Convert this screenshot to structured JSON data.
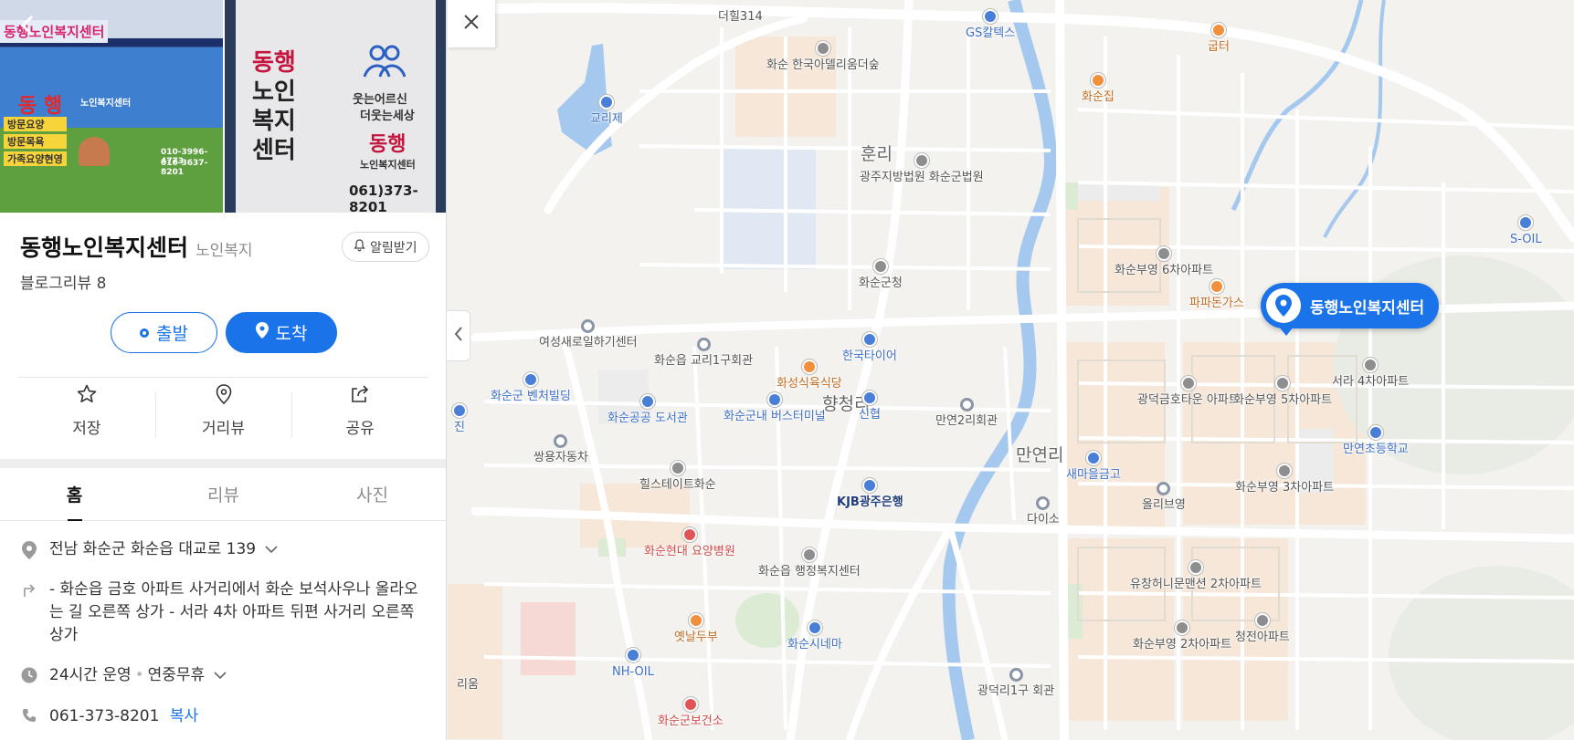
{
  "place": {
    "name": "동행노인복지센터",
    "category": "노인복지",
    "alarm_label": "알림받기",
    "blog_review": "블로그리뷰 8"
  },
  "photos": {
    "left_sign_top": "동행노인복지센터",
    "left_sign_main": "동 행",
    "left_sign_sub": "노인복지센터",
    "left_services": [
      "방문요양",
      "방문목욕",
      "가족요양현영"
    ],
    "left_phone_1": "010-3996-4773",
    "left_phone_2": "010-3637-8201",
    "right_vertical": [
      "동행",
      "노인",
      "복지",
      "센터"
    ],
    "right_slogan_1": "웃는어르신",
    "right_slogan_2": "더웃는세상",
    "right_brand": "동행",
    "right_brand_sub": "노인복지센터",
    "right_phone": "061)373-8201"
  },
  "route": {
    "start_label": "출발",
    "end_label": "도착"
  },
  "actions": [
    {
      "label": "저장",
      "icon": "star-icon"
    },
    {
      "label": "거리뷰",
      "icon": "map-pin-outline-icon"
    },
    {
      "label": "공유",
      "icon": "share-icon"
    }
  ],
  "tabs": [
    {
      "label": "홈",
      "active": true
    },
    {
      "label": "리뷰",
      "active": false
    },
    {
      "label": "사진",
      "active": false
    }
  ],
  "info": {
    "address": "전남 화순군 화순읍 대교로 139",
    "directions": "- 화순읍 금호 아파트 사거리에서 화순 보석사우나 올라오는 길 오른쪽 상가 - 서라 4차 아파트 뒤편 사거리 오른쪽 상가",
    "hours": "24시간 운영",
    "holiday": "연중무휴",
    "phone": "061-373-8201",
    "copy_label": "복사"
  },
  "map": {
    "marker_label": "동행노인복지센터",
    "labels": [
      {
        "text": "더힐314",
        "kind": "plain"
      },
      {
        "text": "GS칼텍스",
        "kind": "blue"
      },
      {
        "text": "굽터",
        "kind": "orange"
      },
      {
        "text": "화순 한국아델리움더숲",
        "kind": "poi"
      },
      {
        "text": "교리제",
        "kind": "blue"
      },
      {
        "text": "화순집",
        "kind": "orange"
      },
      {
        "text": "훈리",
        "kind": "area"
      },
      {
        "text": "광주지방법원 화순군법원",
        "kind": "poi"
      },
      {
        "text": "S-OIL",
        "kind": "blue"
      },
      {
        "text": "화순부영 6차아파트",
        "kind": "poi"
      },
      {
        "text": "화순군청",
        "kind": "poi"
      },
      {
        "text": "파파돈가스",
        "kind": "orange"
      },
      {
        "text": "여성새로일하기센터",
        "kind": "hole"
      },
      {
        "text": "화순읍 교리1구회관",
        "kind": "hole"
      },
      {
        "text": "한국타이어",
        "kind": "blue"
      },
      {
        "text": "화성식육식당",
        "kind": "orange"
      },
      {
        "text": "향청리",
        "kind": "area"
      },
      {
        "text": "신협",
        "kind": "blue"
      },
      {
        "text": "광덕금호타운 아파트",
        "kind": "poi"
      },
      {
        "text": "화순부영 5차아파트",
        "kind": "poi"
      },
      {
        "text": "서라 4차아파트",
        "kind": "poi"
      },
      {
        "text": "화순군 벤처빌딩",
        "kind": "blue"
      },
      {
        "text": "화순공공 도서관",
        "kind": "blue"
      },
      {
        "text": "화순군내 버스터미널",
        "kind": "blue"
      },
      {
        "text": "만연2리회관",
        "kind": "hole"
      },
      {
        "text": "만연초등학교",
        "kind": "blue"
      },
      {
        "text": "쌍용자동차",
        "kind": "hole"
      },
      {
        "text": "만연리",
        "kind": "area"
      },
      {
        "text": "새마을금고",
        "kind": "blue"
      },
      {
        "text": "힐스테이트화순",
        "kind": "poi"
      },
      {
        "text": "KJB광주은행",
        "kind": "bank"
      },
      {
        "text": "올리브영",
        "kind": "hole"
      },
      {
        "text": "화순부영 3차아파트",
        "kind": "poi"
      },
      {
        "text": "다이소",
        "kind": "hole"
      },
      {
        "text": "화순현대 요양병원",
        "kind": "red"
      },
      {
        "text": "화순읍 행정복지센터",
        "kind": "poi"
      },
      {
        "text": "유창허니문맨션 2차아파트",
        "kind": "poi"
      },
      {
        "text": "청전아파트",
        "kind": "poi"
      },
      {
        "text": "옛날두부",
        "kind": "orange"
      },
      {
        "text": "화순시네마",
        "kind": "blue"
      },
      {
        "text": "화순부영 2차아파트",
        "kind": "poi"
      },
      {
        "text": "NH-OIL",
        "kind": "blue"
      },
      {
        "text": "광덕리1구 회관",
        "kind": "hole"
      },
      {
        "text": "리움",
        "kind": "plain"
      },
      {
        "text": "화순군보건소",
        "kind": "red"
      },
      {
        "text": "진",
        "kind": "blue"
      }
    ]
  }
}
